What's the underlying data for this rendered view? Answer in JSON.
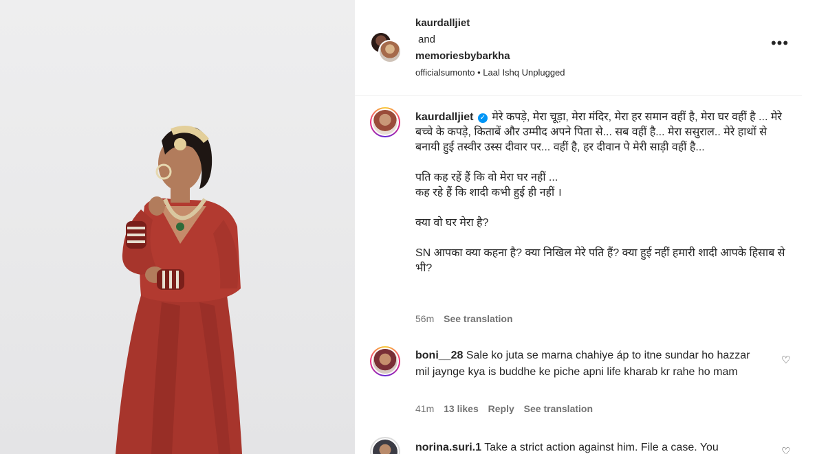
{
  "post_header": {
    "user1": "kaurdalljiet",
    "and_text": "and",
    "user2": "memoriesbybarkha",
    "audio": "officialsumonto • Laal Ishq Unplugged",
    "more_label": "•••"
  },
  "caption": {
    "username": "kaurdalljiet",
    "verified_mark": "✓",
    "para1": "मेरे कपड़े, मेरा चूड़ा, मेरा मंदिर, मेरा हर समान वहीं है, मेरा घर वहीं है ... मेरे बच्चे के कपड़े, किताबें और उम्मीद अपने पिता से... सब वहीं है... मेरा ससुराल.. मेरे हाथों से बनायी हुई तस्वीर उस्स दीवार पर... वहीं है, हर दीवान पे मेरी साड़ी वहीं है...",
    "para2_line1": "पति कह रहें हैं कि वो मेरा घर नहीं ...",
    "para2_line2": "कह रहे हैं कि शादी कभी हुई ही नहीं ।",
    "para3": "क्या वो घर मेरा है?",
    "para4": "SN आपका क्या कहना है? क्या निखिल मेरे पति हैं? क्या हुई नहीं हमारी शादी आपके हिसाब से भी?",
    "time": "56m",
    "see_translation": "See translation"
  },
  "comments": [
    {
      "username": "boni__28",
      "text": "Sale ko juta se marna chahiye áp to itne sundar ho hazzar mil jaynge kya is buddhe ke piche apni life kharab kr rahe ho mam",
      "time": "41m",
      "likes": "13 likes",
      "reply": "Reply",
      "see_translation": "See translation"
    },
    {
      "username": "norina.suri.1",
      "text": "Take a strict action against him. File a case. You"
    }
  ],
  "icons": {
    "heart": "♡"
  }
}
